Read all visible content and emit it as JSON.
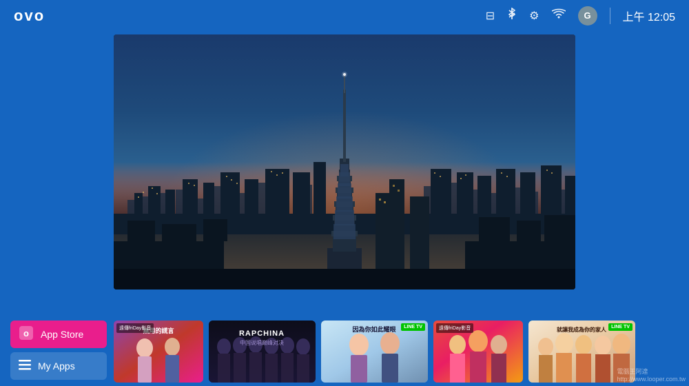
{
  "topbar": {
    "logo": "OVO",
    "time": "上午 12:05",
    "avatar_letter": "G"
  },
  "icons": {
    "hdmi": "⊟",
    "bluetooth": "⚇",
    "settings": "⚙",
    "wifi": "📶"
  },
  "bottom_menu": {
    "app_store_label": "App Store",
    "my_apps_label": "My Apps"
  },
  "thumbnails": [
    {
      "id": 1,
      "badge": "遠傳friDay影音",
      "title": "無用的謊言",
      "brand": "friDay",
      "bg": "pink-drama"
    },
    {
      "id": 2,
      "badge": "",
      "title": "RAPCHINA\n中国说唱巅峰",
      "brand": "",
      "bg": "dark-group"
    },
    {
      "id": 3,
      "badge": "LINE TV",
      "title": "因為你如此耀眼",
      "brand": "LINETV",
      "bg": "couple-drama"
    },
    {
      "id": 4,
      "badge": "遠傳friDay影音",
      "title": "",
      "brand": "friDay",
      "bg": "colorful"
    },
    {
      "id": 5,
      "badge": "LINE TV",
      "title": "就讓我成為你的家人",
      "brand": "LINETV",
      "bg": "light-drama"
    }
  ],
  "watermark": {
    "site": "電腦王阿達",
    "url": "http://www.looper.com.tw"
  }
}
